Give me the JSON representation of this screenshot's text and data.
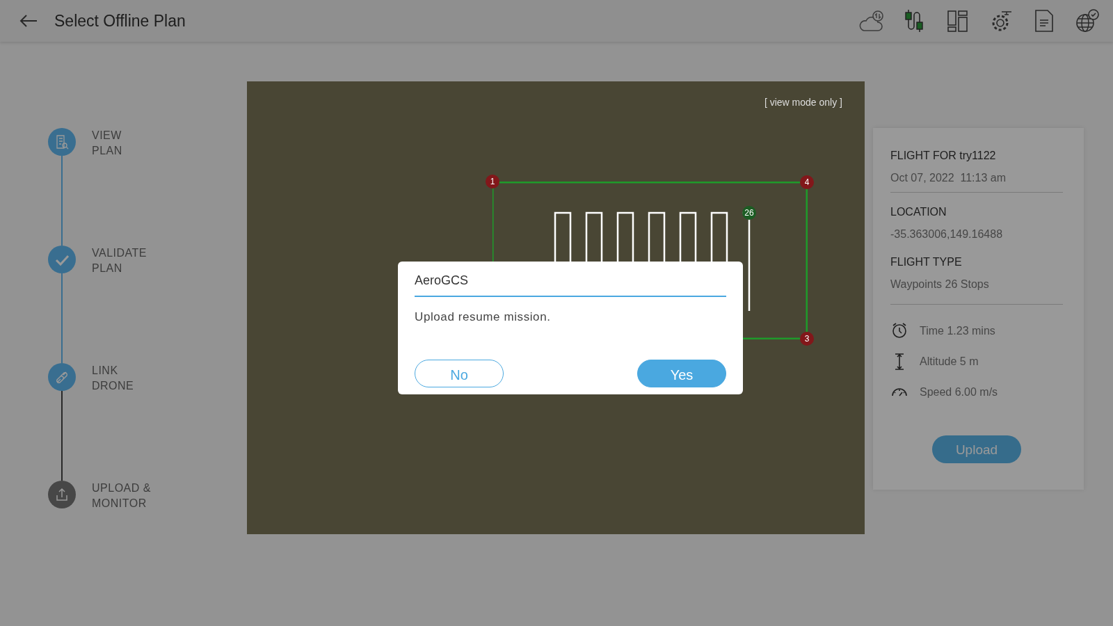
{
  "header": {
    "title": "Select Offline Plan"
  },
  "steps": [
    {
      "lines": [
        "VIEW",
        "PLAN"
      ],
      "kind": "view",
      "completed": true
    },
    {
      "lines": [
        "VALIDATE",
        "PLAN"
      ],
      "kind": "validate",
      "completed": true
    },
    {
      "lines": [
        "LINK",
        "DRONE"
      ],
      "kind": "link",
      "completed": true
    },
    {
      "lines": [
        "UPLOAD &",
        "MONITOR"
      ],
      "kind": "upload",
      "completed": false
    }
  ],
  "map": {
    "mode_label": "[ view mode only ]",
    "waypoints": [
      {
        "label": "1",
        "color": "#82171a"
      },
      {
        "label": "4",
        "color": "#82171a"
      },
      {
        "label": "26",
        "color": "#1c5c23"
      },
      {
        "label": "3",
        "color": "#82171a"
      }
    ]
  },
  "flight": {
    "title": "FLIGHT FOR try1122",
    "date": "Oct 07, 2022  11:13 am",
    "sections": [
      {
        "label": "LOCATION",
        "value": "-35.363006,149.16488"
      },
      {
        "label": "FLIGHT TYPE",
        "value": "Waypoints 26 Stops"
      }
    ],
    "stats": [
      {
        "kind": "time",
        "text": "Time 1.23 mins"
      },
      {
        "kind": "altitude",
        "text": "Altitude 5 m"
      },
      {
        "kind": "speed",
        "text": "Speed 6.00 m/s"
      }
    ],
    "button": "Upload"
  },
  "dialog": {
    "title": "AeroGCS",
    "message": "Upload resume mission.",
    "buttons": [
      {
        "label": "No",
        "kind": "outline"
      },
      {
        "label": "Yes",
        "kind": "primary"
      }
    ]
  }
}
